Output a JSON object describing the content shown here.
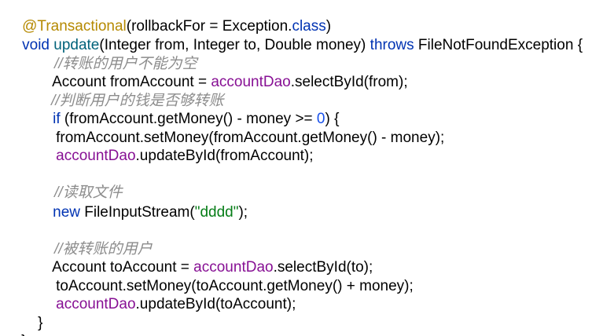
{
  "editor": {
    "lines": [
      {
        "tokens": [
          {
            "text": "@Transactional",
            "kind": "annotation"
          },
          {
            "text": "(rollbackFor = Exception.",
            "kind": "plain"
          },
          {
            "text": "class",
            "kind": "keyword"
          },
          {
            "text": ")",
            "kind": "plain"
          }
        ]
      },
      {
        "tokens": [
          {
            "text": "void ",
            "kind": "keyword"
          },
          {
            "text": "update",
            "kind": "method-decl"
          },
          {
            "text": "(Integer from, Integer to, Double money) ",
            "kind": "plain"
          },
          {
            "text": "throws",
            "kind": "keyword"
          },
          {
            "text": " FileNotFoundException {",
            "kind": "plain"
          }
        ]
      },
      {
        "tokens": [
          {
            "text": "//转账的用户不能为空",
            "kind": "comment"
          }
        ]
      },
      {
        "tokens": [
          {
            "text": "Account fromAccount = ",
            "kind": "plain"
          },
          {
            "text": "accountDao",
            "kind": "field"
          },
          {
            "text": ".selectById(from);",
            "kind": "plain"
          }
        ]
      },
      {
        "tokens": [
          {
            "text": "//判断用户的钱是否够转账",
            "kind": "comment"
          }
        ]
      },
      {
        "tokens": [
          {
            "text": "if",
            "kind": "keyword"
          },
          {
            "text": " (fromAccount.getMoney() - money >= ",
            "kind": "plain"
          },
          {
            "text": "0",
            "kind": "number"
          },
          {
            "text": ") {",
            "kind": "plain"
          }
        ]
      },
      {
        "tokens": [
          {
            "text": "fromAccount.setMoney(fromAccount.getMoney() - money);",
            "kind": "plain"
          }
        ]
      },
      {
        "tokens": [
          {
            "text": "accountDao",
            "kind": "field"
          },
          {
            "text": ".updateById(fromAccount);",
            "kind": "plain"
          }
        ]
      },
      {
        "tokens": [
          {
            "text": "//读取文件",
            "kind": "comment"
          }
        ]
      },
      {
        "tokens": [
          {
            "text": "new",
            "kind": "keyword"
          },
          {
            "text": " FileInputStream(",
            "kind": "plain"
          },
          {
            "text": "\"dddd\"",
            "kind": "string"
          },
          {
            "text": ");",
            "kind": "plain"
          }
        ]
      },
      {
        "tokens": [
          {
            "text": "//被转账的用户",
            "kind": "comment"
          }
        ]
      },
      {
        "tokens": [
          {
            "text": "Account toAccount = ",
            "kind": "plain"
          },
          {
            "text": "accountDao",
            "kind": "field"
          },
          {
            "text": ".selectById(to);",
            "kind": "plain"
          }
        ]
      },
      {
        "tokens": [
          {
            "text": "toAccount.setMoney(toAccount.getMoney() + money);",
            "kind": "plain"
          }
        ]
      },
      {
        "tokens": [
          {
            "text": "accountDao",
            "kind": "field"
          },
          {
            "text": ".updateById(toAccount);",
            "kind": "plain"
          }
        ]
      },
      {
        "tokens": [
          {
            "text": "}",
            "kind": "plain"
          }
        ]
      },
      {
        "tokens": [
          {
            "text": "}",
            "kind": "plain"
          }
        ]
      }
    ]
  }
}
